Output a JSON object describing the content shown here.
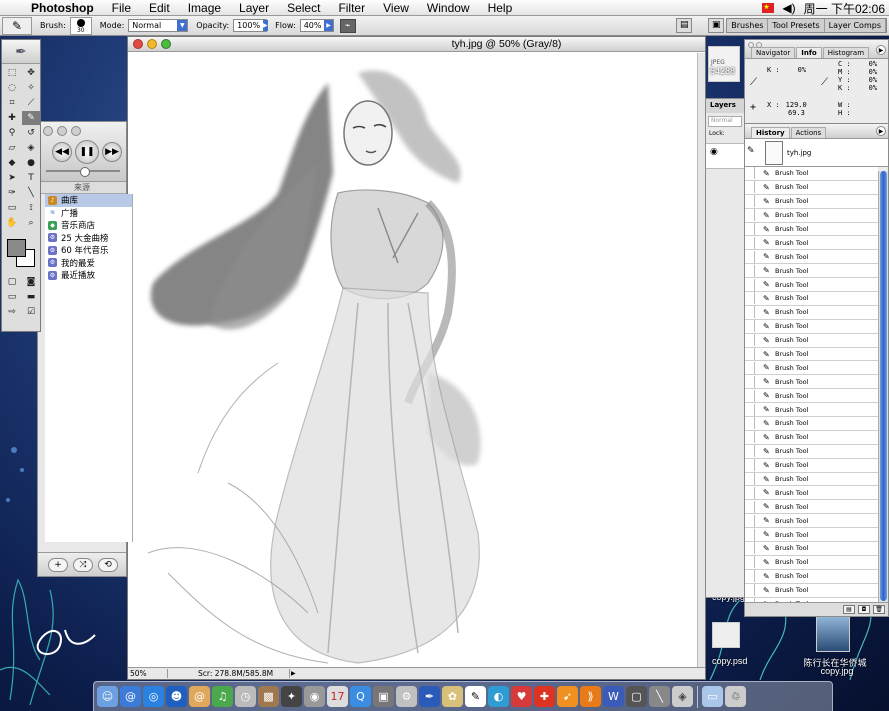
{
  "menubar": {
    "app_name": "Photoshop",
    "items": [
      "File",
      "Edit",
      "Image",
      "Layer",
      "Select",
      "Filter",
      "View",
      "Window",
      "Help"
    ],
    "clock": "周一 下午02:06"
  },
  "options": {
    "brush_label": "Brush:",
    "brush_size": "30",
    "mode_label": "Mode:",
    "mode_value": "Normal",
    "opacity_label": "Opacity:",
    "opacity_value": "100%",
    "flow_label": "Flow:",
    "flow_value": "40%",
    "well_tabs": [
      "Brushes",
      "Tool Presets",
      "Layer Comps"
    ]
  },
  "document": {
    "title": "tyh.jpg @ 50% (Gray/8)",
    "zoom": "50%",
    "scratch": "Scr: 278.8M/585.8M"
  },
  "music": {
    "source_header": "来源",
    "sources": [
      "曲库",
      "广播",
      "音乐商店",
      "25 大金曲榜",
      "60 年代音乐",
      "我的最爱",
      "最近播放"
    ]
  },
  "navigator": {
    "tabs": [
      "Navigator",
      "Info",
      "Histogram"
    ],
    "active_tab": "Info",
    "k_label": "K :",
    "k_value": "0%",
    "c_label": "C :",
    "c_value": "0%",
    "m_label": "M :",
    "m_value": "0%",
    "y_label": "Y :",
    "y_value": "0%",
    "k2_label": "K :",
    "k2_value": "0%",
    "x_label": "X :",
    "x_value": "129.0",
    "y2_value": "69.3",
    "w_label": "W :",
    "h_label": "H :",
    "partial_number": "54288"
  },
  "layers": {
    "title": "Layers",
    "blend": "Normal",
    "lock_label": "Lock:"
  },
  "history": {
    "tabs": [
      "History",
      "Actions"
    ],
    "active_tab": "History",
    "snapshot": "tyh.jpg",
    "step_label": "Brush Tool",
    "steps": [
      "Brush Tool",
      "Brush Tool",
      "Brush Tool",
      "Brush Tool",
      "Brush Tool",
      "Brush Tool",
      "Brush Tool",
      "Brush Tool",
      "Brush Tool",
      "Brush Tool",
      "Brush Tool",
      "Brush Tool",
      "Brush Tool",
      "Brush Tool",
      "Brush Tool",
      "Brush Tool",
      "Brush Tool",
      "Brush Tool",
      "Brush Tool",
      "Brush Tool",
      "Brush Tool",
      "Brush Tool",
      "Brush Tool",
      "Brush Tool",
      "Brush Tool",
      "Brush Tool",
      "Brush Tool",
      "Brush Tool",
      "Brush Tool",
      "Brush Tool",
      "Brush Tool",
      "Brush Tool"
    ]
  },
  "desktop": {
    "file1": "copy.jpg",
    "file2": "copy.psd",
    "file3_line1": "陈行长在华侨城",
    "file3_line2": "copy.jpg",
    "file4": "JPEG"
  },
  "colors": {
    "accent": "#3f6fd1",
    "foreground": "#8a8a8a",
    "background": "#ffffff"
  }
}
